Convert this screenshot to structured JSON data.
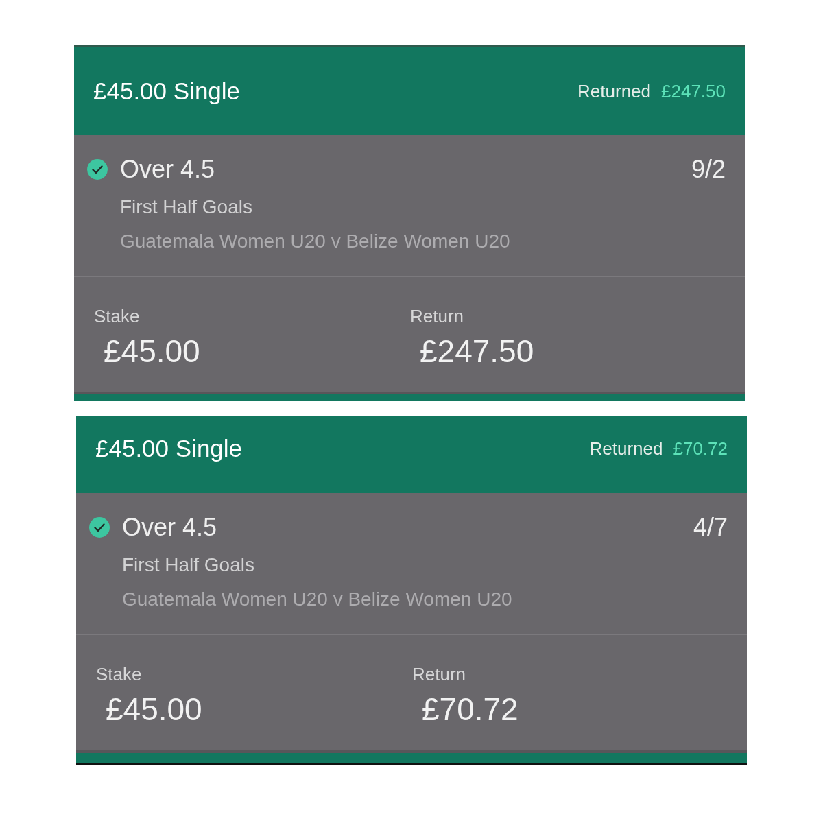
{
  "bets": [
    {
      "title": "£45.00 Single",
      "returned_label": "Returned",
      "returned_amount": "£247.50",
      "selection": {
        "won": true,
        "name": "Over 4.5",
        "odds": "9/2",
        "market": "First Half Goals",
        "event": "Guatemala Women U20 v Belize Women U20"
      },
      "stake_label": "Stake",
      "stake": "£45.00",
      "return_label": "Return",
      "return": "£247.50"
    },
    {
      "title": "£45.00 Single",
      "returned_label": "Returned",
      "returned_amount": "£70.72",
      "selection": {
        "won": true,
        "name": "Over 4.5",
        "odds": "4/7",
        "market": "First Half Goals",
        "event": "Guatemala Women U20 v Belize Women U20"
      },
      "stake_label": "Stake",
      "stake": "£45.00",
      "return_label": "Return",
      "return": "£70.72"
    }
  ]
}
